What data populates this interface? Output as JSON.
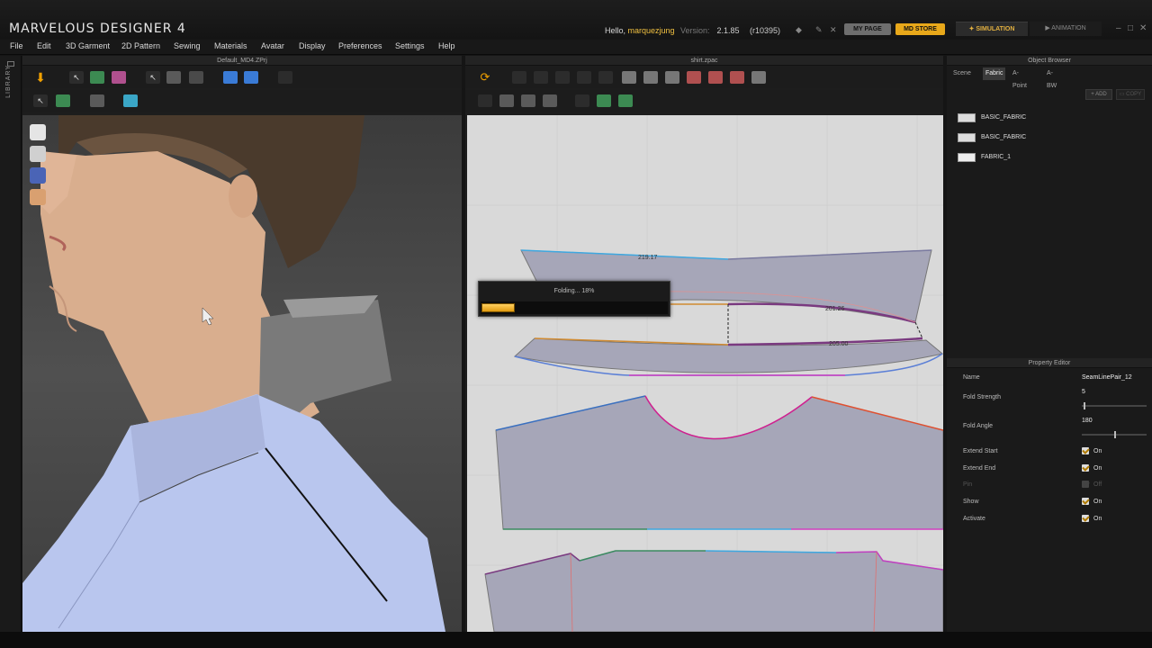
{
  "app": {
    "title": "MARVELOUS DESIGNER 4",
    "hello_prefix": "Hello,",
    "user": "marquezjung",
    "version_label": "Version:",
    "version": "2.1.85",
    "build": "(r10395)",
    "my_page": "MY PAGE",
    "md_store": "MD STORE",
    "mode_simulation": "SIMULATION",
    "mode_animation": "ANIMATION"
  },
  "menu": [
    "File",
    "Edit",
    "3D Garment",
    "2D Pattern",
    "Sewing",
    "Materials",
    "Avatar",
    "Display",
    "Preferences",
    "Settings",
    "Help"
  ],
  "library": {
    "label": "LIBRARY"
  },
  "panel3d": {
    "title": "Default_MD4.ZPrj"
  },
  "panel2d": {
    "title": "shirt.zpac",
    "progress": {
      "label": "Folding... 18%",
      "value": 0.18
    },
    "measures": [
      "219.17",
      "201.26",
      "205.00"
    ]
  },
  "object_browser": {
    "title": "Object Browser",
    "tabs": [
      "Scene",
      "Fabric",
      "A-Point",
      "A-BW"
    ],
    "active_tab": "Fabric",
    "add": "ADD",
    "copy": "COPY",
    "fabrics": [
      "BASIC_FABRIC",
      "BASIC_FABRIC",
      "FABRIC_1"
    ]
  },
  "property_editor": {
    "title": "Property Editor",
    "name_label": "Name",
    "name_value": "SeamLinePair_12",
    "fold_strength_label": "Fold Strength",
    "fold_strength_value": "5",
    "fold_angle_label": "Fold Angle",
    "fold_angle_value": "180",
    "extend_start_label": "Extend Start",
    "extend_start_value": "On",
    "extend_end_label": "Extend End",
    "extend_end_value": "On",
    "pin_label": "Pin",
    "pin_value": "Off",
    "show_label": "Show",
    "show_value": "On",
    "activate_label": "Activate",
    "activate_value": "On"
  },
  "colors": {
    "accent": "#e8a81a",
    "viewport2d": "#d9d9d9",
    "pattern": "#a6a6b8",
    "shirt": "#b9c6ee"
  }
}
